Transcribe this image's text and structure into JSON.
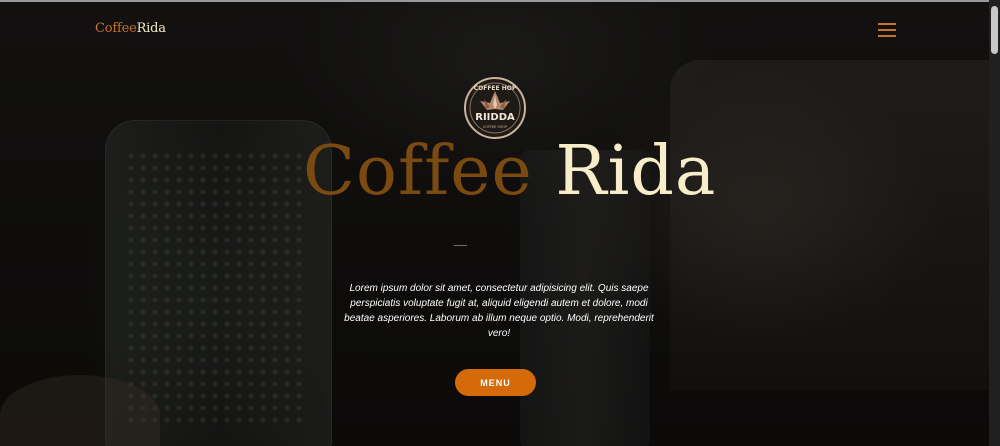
{
  "brand": {
    "part1": "Coffee",
    "part2": "Rida"
  },
  "logo": {
    "top_text": "COFFEE HOP",
    "name": "RIIDDA",
    "bottom_text": "COFFEE SHOP"
  },
  "hero": {
    "title_part1": "Coffee",
    "title_part2": "Rida",
    "description": "Lorem ipsum dolor sit amet, consectetur adipisicing elit. Quis saepe perspiciatis voluptate fugit at, aliquid eligendi autem et dolore, modi beatae asperiores. Laborum ab illum neque optio. Modi, reprehenderit vero!",
    "button_label": "MENU"
  },
  "icons": {
    "menu": "hamburger-icon"
  },
  "colors": {
    "accent": "#d46a0a",
    "brand_brown": "#7a4a10",
    "cream": "#f7eec9",
    "hamburger": "#c9732a"
  }
}
